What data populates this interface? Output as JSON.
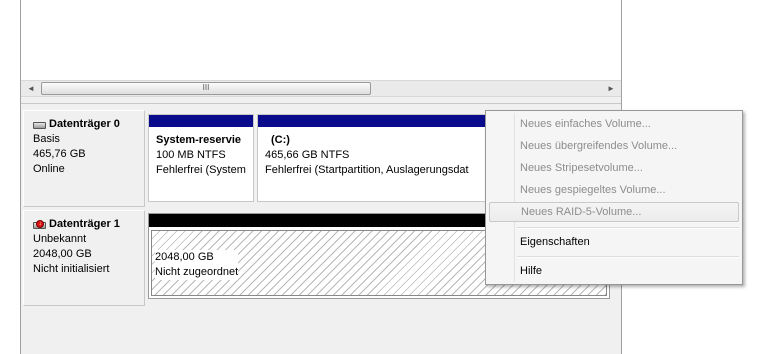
{
  "list_scroll": {
    "thumb_glyph": "III",
    "left_arrow": "◄",
    "right_arrow": "►"
  },
  "disks": [
    {
      "name": "Datenträger 0",
      "type": "Basis",
      "size": "465,76 GB",
      "status": "Online"
    },
    {
      "name": "Datenträger 1",
      "type": "Unbekannt",
      "size": "2048,00 GB",
      "status": "Nicht initialisiert"
    }
  ],
  "disk0_partitions": [
    {
      "title": "System-reservie",
      "size_fs": "100 MB NTFS",
      "status": "Fehlerfrei (System"
    },
    {
      "title": "(C:)",
      "size_fs": "465,66 GB NTFS",
      "status": "Fehlerfrei (Startpartition, Auslagerungsdat"
    }
  ],
  "disk1_unallocated": {
    "size": "2048,00 GB",
    "status": "Nicht zugeordnet"
  },
  "context_menu": {
    "items": [
      {
        "label": "Neues einfaches Volume...",
        "enabled": false
      },
      {
        "label": "Neues übergreifendes Volume...",
        "enabled": false
      },
      {
        "label": "Neues Stripesetvolume...",
        "enabled": false
      },
      {
        "label": "Neues gespiegeltes Volume...",
        "enabled": false
      },
      {
        "label": "Neues RAID-5-Volume...",
        "enabled": false,
        "hover": true
      },
      {
        "label": "Eigenschaften",
        "enabled": true
      },
      {
        "label": "Hilfe",
        "enabled": true
      }
    ]
  },
  "colors": {
    "partition_bar": "#0a0a8c",
    "unallocated_bar": "#000000",
    "disabled_text": "#8d8d8d"
  }
}
